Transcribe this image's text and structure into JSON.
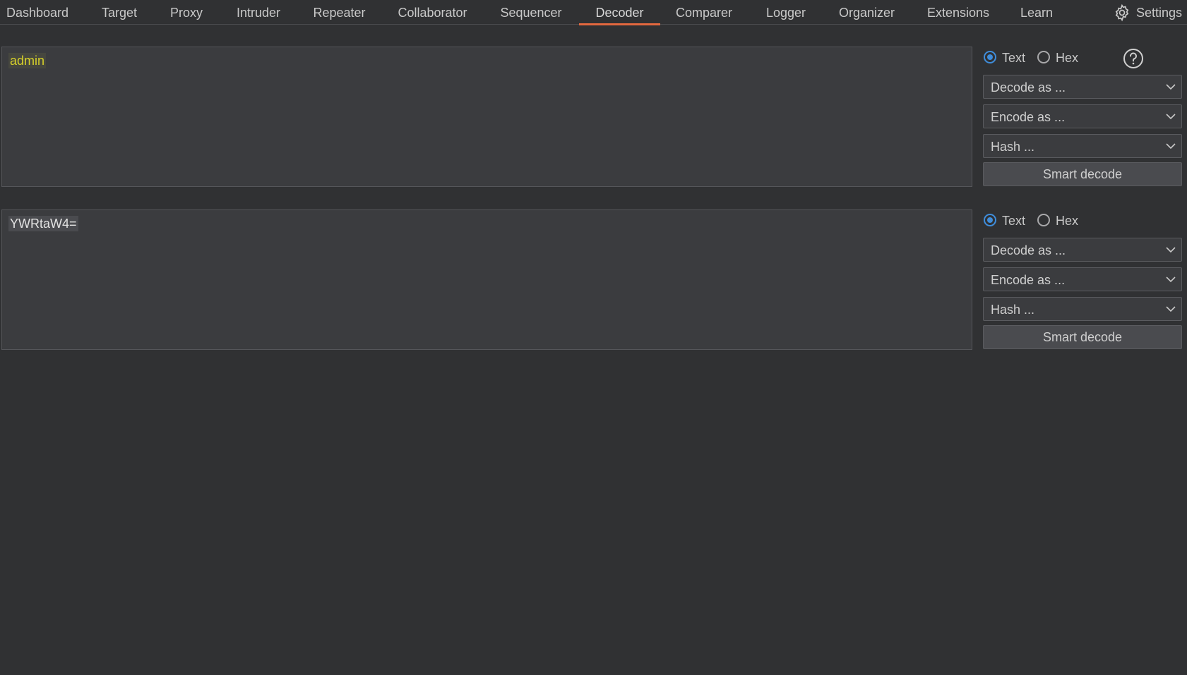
{
  "tabs": [
    {
      "label": "Dashboard",
      "active": false
    },
    {
      "label": "Target",
      "active": false
    },
    {
      "label": "Proxy",
      "active": false
    },
    {
      "label": "Intruder",
      "active": false
    },
    {
      "label": "Repeater",
      "active": false
    },
    {
      "label": "Collaborator",
      "active": false
    },
    {
      "label": "Sequencer",
      "active": false
    },
    {
      "label": "Decoder",
      "active": true
    },
    {
      "label": "Comparer",
      "active": false
    },
    {
      "label": "Logger",
      "active": false
    },
    {
      "label": "Organizer",
      "active": false
    },
    {
      "label": "Extensions",
      "active": false
    },
    {
      "label": "Learn",
      "active": false
    }
  ],
  "settings": {
    "label": "Settings",
    "icon": "gear-icon"
  },
  "colors": {
    "accent": "#e3683f",
    "radio_selected": "#3f8ddb",
    "input_text_highlight": "#d6d02a",
    "background": "#303133"
  },
  "panels": [
    {
      "editor_text": "admin",
      "radio_text": "Text",
      "radio_hex": "Hex",
      "selected_format": "Text",
      "decode_select": "Decode as ...",
      "encode_select": "Encode as ...",
      "hash_select": "Hash ...",
      "smart_decode": "Smart decode",
      "help_icon": "help-icon"
    },
    {
      "editor_text": "YWRtaW4=",
      "radio_text": "Text",
      "radio_hex": "Hex",
      "selected_format": "Text",
      "decode_select": "Decode as ...",
      "encode_select": "Encode as ...",
      "hash_select": "Hash ...",
      "smart_decode": "Smart decode"
    }
  ]
}
